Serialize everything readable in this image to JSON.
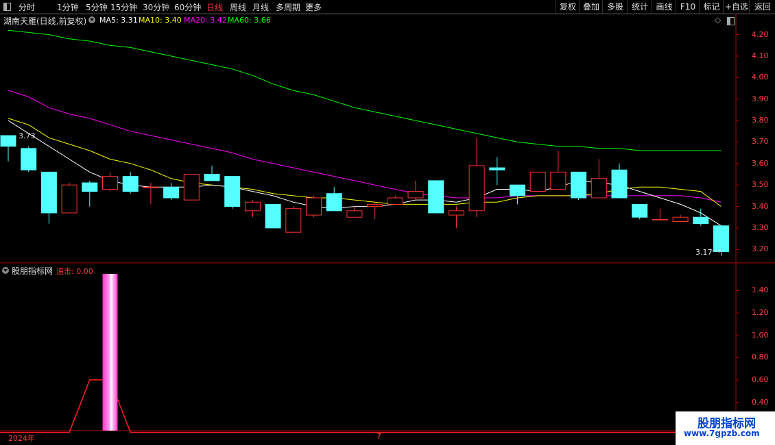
{
  "toolbar": {
    "periods": [
      "分时",
      "1分钟",
      "5分钟",
      "15分钟",
      "30分钟",
      "60分钟",
      "日线",
      "周线",
      "月线",
      "多周期",
      "更多"
    ],
    "active_period": "日线",
    "right_buttons": [
      "复权",
      "叠加",
      "多股",
      "统计",
      "画线",
      "F10",
      "标记",
      "+自选",
      "返回"
    ]
  },
  "main_chart": {
    "title": "湖南天雁(日线,前复权)",
    "ma_labels": [
      {
        "text": "MA5: 3.31",
        "color": "#ffffff"
      },
      {
        "text": "MA10: 3.40",
        "color": "#ffff00"
      },
      {
        "text": "MA20: 3.42",
        "color": "#ff00ff"
      },
      {
        "text": "MA60: 3.66",
        "color": "#00ff00"
      }
    ],
    "annotations": {
      "high_label": "3.73",
      "low_label": "3.17"
    }
  },
  "sub_chart": {
    "title": "股朋指标网",
    "indicator_label": "追击: 0.00"
  },
  "date_labels": {
    "start": "2024年",
    "mid": "7"
  },
  "watermark": {
    "title": "股朋指标网",
    "url": "www.7gpzb.com"
  },
  "colors": {
    "up": "#ff3333",
    "down": "#54ffff",
    "ma5": "#ffffff",
    "ma10": "#ffff00",
    "ma20": "#ff00ff",
    "ma60": "#00ff00"
  },
  "chart_data": [
    {
      "type": "candlestick",
      "title": "湖南天雁(日线,前复权)",
      "ylim": [
        3.15,
        4.24
      ],
      "y_ticks": [
        "4.20",
        "4.10",
        "4.00",
        "3.90",
        "3.80",
        "3.70",
        "3.60",
        "3.50",
        "3.40",
        "3.30",
        "3.20"
      ],
      "candles": [
        {
          "o": 3.73,
          "c": 3.68,
          "h": 3.73,
          "l": 3.61
        },
        {
          "o": 3.67,
          "c": 3.57,
          "h": 3.68,
          "l": 3.56
        },
        {
          "o": 3.56,
          "c": 3.37,
          "h": 3.56,
          "l": 3.32
        },
        {
          "o": 3.37,
          "c": 3.5,
          "h": 3.51,
          "l": 3.37
        },
        {
          "o": 3.51,
          "c": 3.47,
          "h": 3.52,
          "l": 3.4
        },
        {
          "o": 3.48,
          "c": 3.54,
          "h": 3.56,
          "l": 3.47
        },
        {
          "o": 3.54,
          "c": 3.47,
          "h": 3.56,
          "l": 3.46
        },
        {
          "o": 3.49,
          "c": 3.49,
          "h": 3.51,
          "l": 3.41
        },
        {
          "o": 3.49,
          "c": 3.44,
          "h": 3.51,
          "l": 3.43
        },
        {
          "o": 3.43,
          "c": 3.55,
          "h": 3.55,
          "l": 3.43
        },
        {
          "o": 3.55,
          "c": 3.52,
          "h": 3.59,
          "l": 3.52
        },
        {
          "o": 3.54,
          "c": 3.4,
          "h": 3.54,
          "l": 3.39
        },
        {
          "o": 3.38,
          "c": 3.42,
          "h": 3.43,
          "l": 3.35
        },
        {
          "o": 3.41,
          "c": 3.3,
          "h": 3.41,
          "l": 3.3
        },
        {
          "o": 3.28,
          "c": 3.39,
          "h": 3.4,
          "l": 3.28
        },
        {
          "o": 3.36,
          "c": 3.44,
          "h": 3.45,
          "l": 3.35
        },
        {
          "o": 3.46,
          "c": 3.38,
          "h": 3.49,
          "l": 3.38
        },
        {
          "o": 3.35,
          "c": 3.38,
          "h": 3.4,
          "l": 3.35
        },
        {
          "o": 3.4,
          "c": 3.41,
          "h": 3.42,
          "l": 3.34
        },
        {
          "o": 3.41,
          "c": 3.44,
          "h": 3.45,
          "l": 3.41
        },
        {
          "o": 3.44,
          "c": 3.47,
          "h": 3.52,
          "l": 3.43
        },
        {
          "o": 3.52,
          "c": 3.37,
          "h": 3.52,
          "l": 3.37
        },
        {
          "o": 3.36,
          "c": 3.38,
          "h": 3.4,
          "l": 3.3
        },
        {
          "o": 3.38,
          "c": 3.59,
          "h": 3.72,
          "l": 3.35
        },
        {
          "o": 3.58,
          "c": 3.57,
          "h": 3.63,
          "l": 3.5
        },
        {
          "o": 3.5,
          "c": 3.45,
          "h": 3.5,
          "l": 3.41
        },
        {
          "o": 3.47,
          "c": 3.56,
          "h": 3.56,
          "l": 3.47
        },
        {
          "o": 3.48,
          "c": 3.56,
          "h": 3.66,
          "l": 3.48
        },
        {
          "o": 3.56,
          "c": 3.44,
          "h": 3.56,
          "l": 3.43
        },
        {
          "o": 3.44,
          "c": 3.53,
          "h": 3.62,
          "l": 3.44
        },
        {
          "o": 3.57,
          "c": 3.44,
          "h": 3.6,
          "l": 3.44
        },
        {
          "o": 3.41,
          "c": 3.35,
          "h": 3.41,
          "l": 3.34
        },
        {
          "o": 3.34,
          "c": 3.34,
          "h": 3.39,
          "l": 3.34
        },
        {
          "o": 3.33,
          "c": 3.35,
          "h": 3.36,
          "l": 3.33
        },
        {
          "o": 3.35,
          "c": 3.32,
          "h": 3.39,
          "l": 3.31
        },
        {
          "o": 3.31,
          "c": 3.19,
          "h": 3.31,
          "l": 3.17
        }
      ],
      "ma5": [
        3.8,
        3.74,
        3.68,
        3.62,
        3.56,
        3.52,
        3.5,
        3.49,
        3.49,
        3.49,
        3.5,
        3.49,
        3.47,
        3.45,
        3.42,
        3.4,
        3.39,
        3.4,
        3.4,
        3.41,
        3.43,
        3.43,
        3.42,
        3.44,
        3.48,
        3.48,
        3.47,
        3.49,
        3.52,
        3.51,
        3.5,
        3.47,
        3.44,
        3.41,
        3.37,
        3.31
      ],
      "ma10": [
        3.81,
        3.78,
        3.72,
        3.69,
        3.66,
        3.62,
        3.6,
        3.57,
        3.53,
        3.51,
        3.5,
        3.49,
        3.48,
        3.46,
        3.45,
        3.44,
        3.44,
        3.43,
        3.42,
        3.41,
        3.41,
        3.41,
        3.41,
        3.42,
        3.42,
        3.44,
        3.45,
        3.45,
        3.45,
        3.46,
        3.48,
        3.49,
        3.49,
        3.48,
        3.47,
        3.4
      ],
      "ma20": [
        3.94,
        3.91,
        3.86,
        3.83,
        3.81,
        3.78,
        3.75,
        3.73,
        3.71,
        3.69,
        3.67,
        3.65,
        3.62,
        3.6,
        3.58,
        3.56,
        3.54,
        3.52,
        3.5,
        3.48,
        3.46,
        3.45,
        3.44,
        3.44,
        3.44,
        3.45,
        3.45,
        3.45,
        3.45,
        3.45,
        3.45,
        3.45,
        3.45,
        3.45,
        3.44,
        3.42
      ],
      "ma60": [
        4.22,
        4.21,
        4.2,
        4.18,
        4.17,
        4.15,
        4.14,
        4.12,
        4.1,
        4.08,
        4.06,
        4.04,
        4.01,
        3.97,
        3.94,
        3.92,
        3.89,
        3.86,
        3.84,
        3.82,
        3.8,
        3.78,
        3.76,
        3.74,
        3.72,
        3.7,
        3.69,
        3.68,
        3.68,
        3.67,
        3.67,
        3.66,
        3.66,
        3.66,
        3.66,
        3.66
      ]
    },
    {
      "type": "bar",
      "title": "股朋指标网",
      "ylim": [
        0.17,
        1.55
      ],
      "y_ticks": [
        "1.40",
        "1.20",
        "1.00",
        "0.80",
        "0.60",
        "0.40",
        "0.20"
      ],
      "signal_index": 5,
      "signal_value": 1.55,
      "line": [
        0,
        0,
        0,
        0,
        0.6,
        0.6,
        0,
        0,
        0,
        0,
        0,
        0,
        0,
        0,
        0,
        0,
        0,
        0,
        0,
        0,
        0,
        0,
        0,
        0,
        0,
        0,
        0,
        0,
        0,
        0,
        0,
        0,
        0,
        0,
        0,
        0
      ]
    }
  ]
}
